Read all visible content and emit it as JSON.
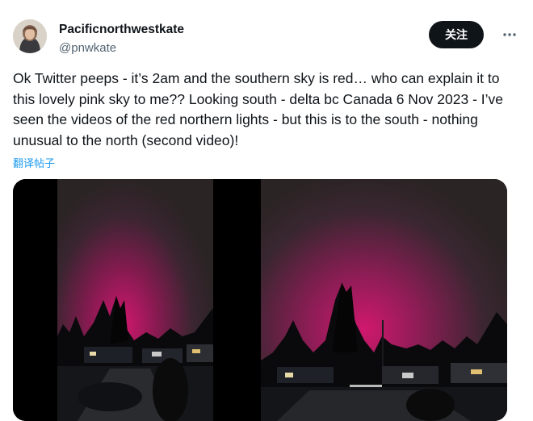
{
  "user": {
    "display_name": "Pacificnorthwestkate",
    "handle": "@pnwkate",
    "avatar_icon": "user-avatar"
  },
  "actions": {
    "follow_label": "关注",
    "more_icon": "more-horizontal-icon"
  },
  "tweet": {
    "text": "Ok Twitter peeps - it’s 2am and the southern sky is red… who can explain it to this lovely pink sky to me?? Looking south - delta bc Canada 6 Nov 2023 - I’ve seen the videos of the red northern lights - but this is to the south - nothing unusual to the north (second video)!",
    "translate_label": "翻译帖子"
  },
  "media": {
    "items": [
      {
        "kind": "video",
        "subject": "pink night sky over trees and houses"
      },
      {
        "kind": "video",
        "subject": "pink night sky over trees and houses"
      }
    ],
    "colors": {
      "sky_dark": "#2a2424",
      "sky_glow": "#d0186e",
      "link": "#1d9bf0"
    }
  }
}
